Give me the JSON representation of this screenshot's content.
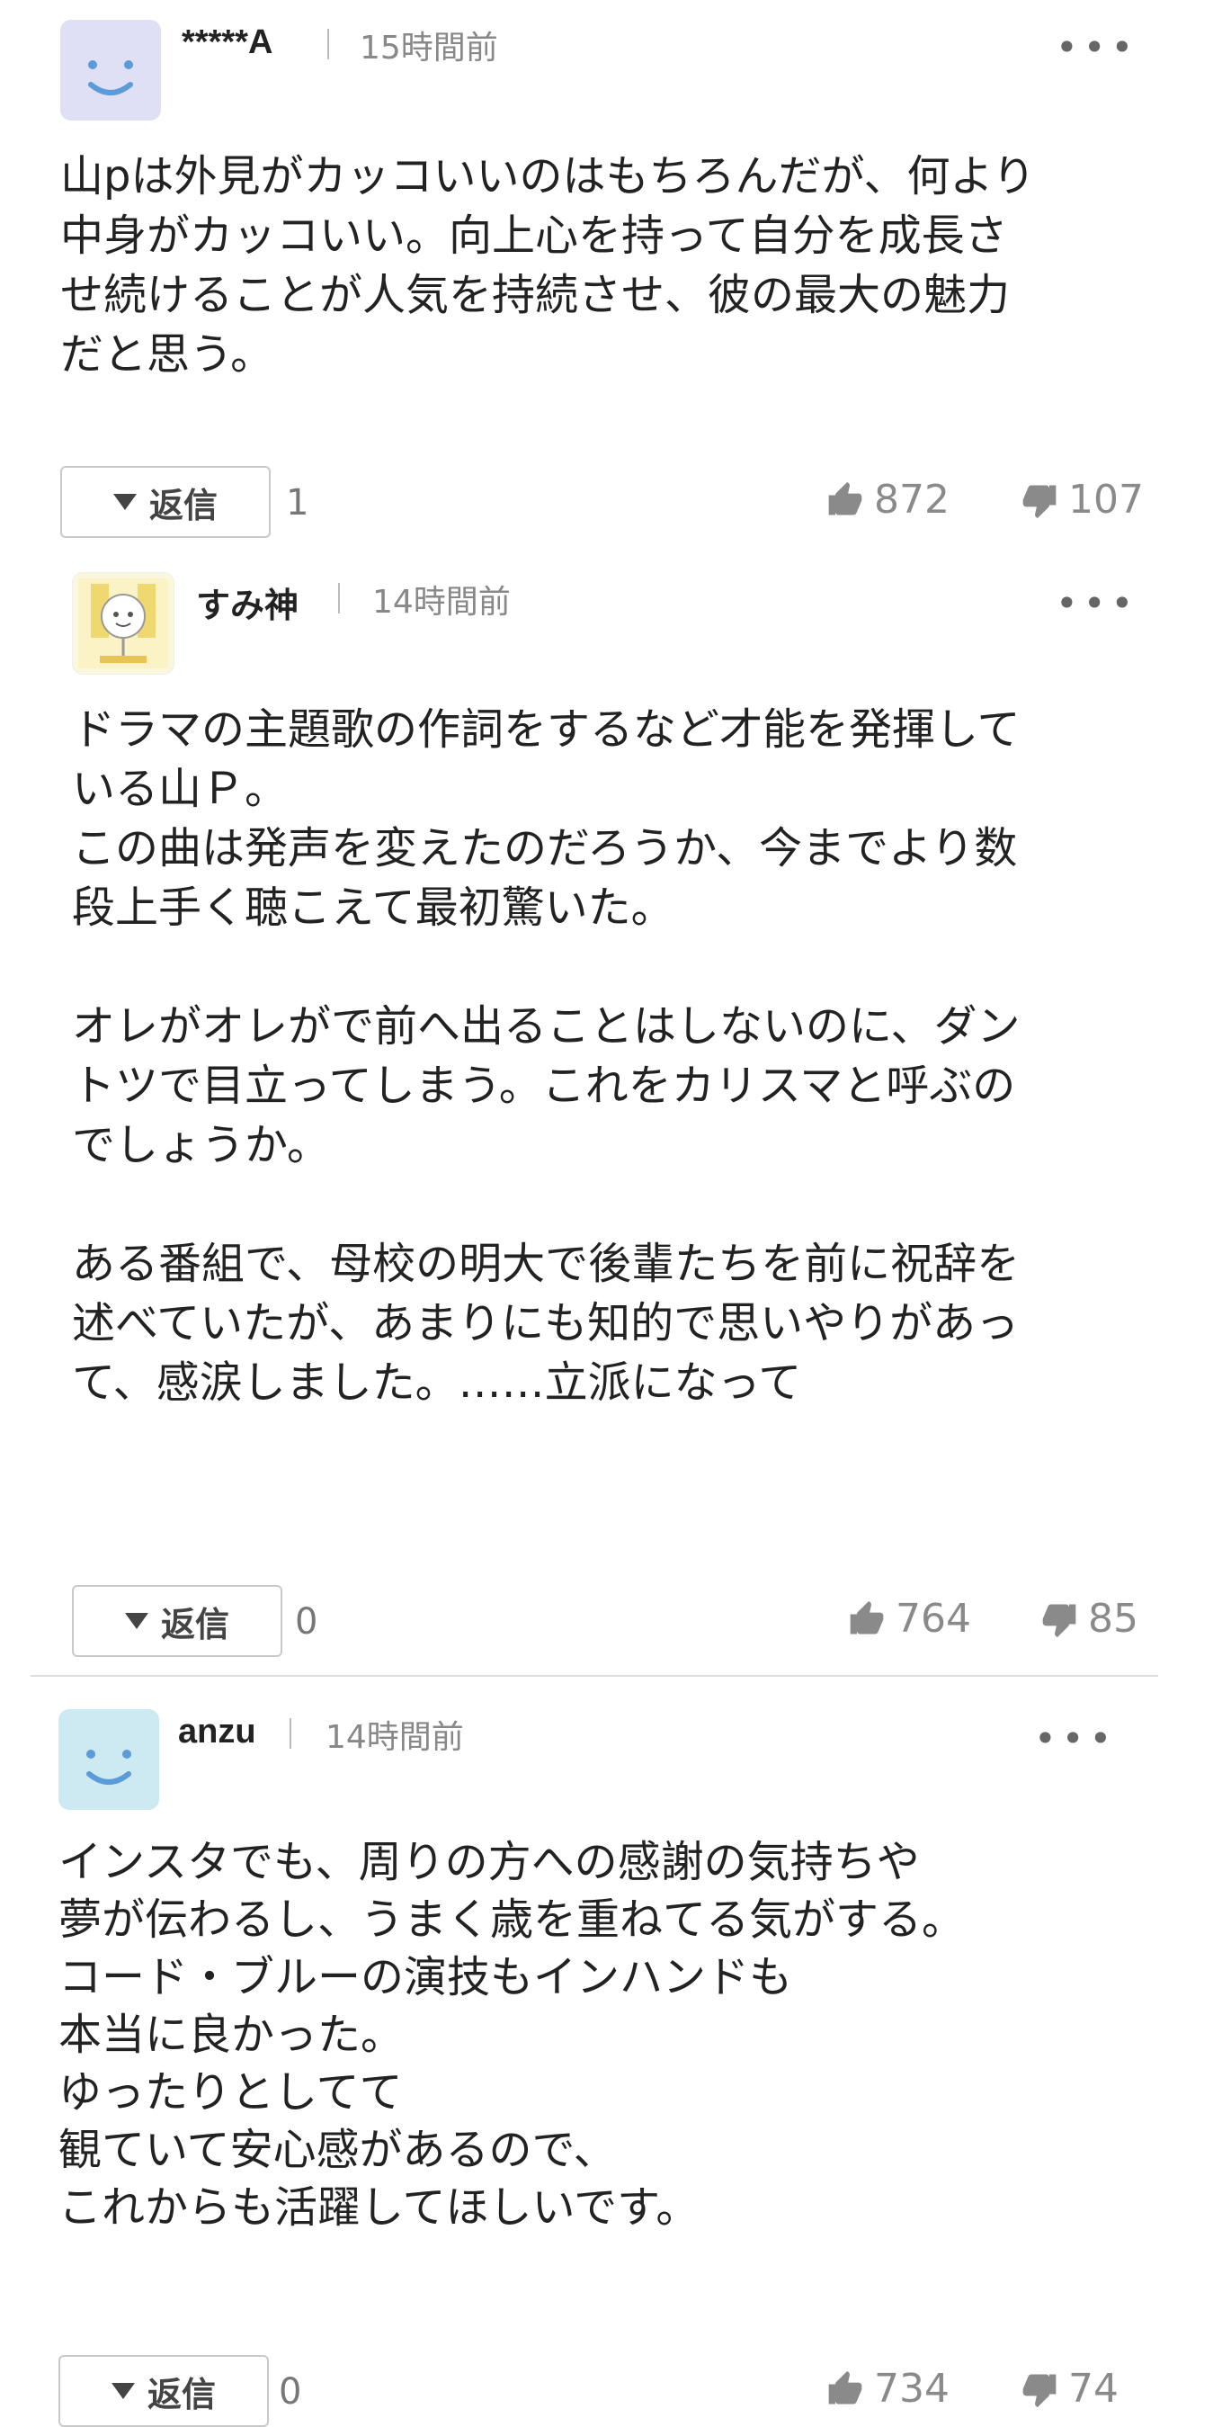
{
  "comments": [
    {
      "username": "*****A",
      "time": "15時間前",
      "text": "山pは外見がカッコいいのはもちろんだが、何より\n中身がカッコいい。向上心を持って自分を成長さ\nせ続けることが人気を持続させ、彼の最大の魅力\nだと思う。",
      "reply_label": "返信",
      "reply_count": "1",
      "likes": "872",
      "dislikes": "107",
      "avatar_color": "#dfe0f5"
    },
    {
      "username": "すみ神",
      "time": "14時間前",
      "text": "ドラマの主題歌の作詞をするなど才能を発揮して\nいる山Ｐ。\nこの曲は発声を変えたのだろうか、今までより数\n段上手く聴こえて最初驚いた。\n\nオレがオレがで前へ出ることはしないのに、ダン\nトツで目立ってしまう。これをカリスマと呼ぶの\nでしょうか。\n\nある番組で、母校の明大で後輩たちを前に祝辞を\n述べていたが、あまりにも知的で思いやりがあっ\nて、感涙しました。……立派になって",
      "reply_label": "返信",
      "reply_count": "0",
      "likes": "764",
      "dislikes": "85",
      "avatar_color": "#fbf3c6"
    },
    {
      "username": "anzu",
      "time": "14時間前",
      "text": "インスタでも、周りの方への感謝の気持ちや\n夢が伝わるし、うまく歳を重ねてる気がする。\nコード・ブルーの演技もインハンドも\n本当に良かった。\nゆったりとしてて\n観ていて安心感があるので、\nこれからも活躍してほしいです。",
      "reply_label": "返信",
      "reply_count": "0",
      "likes": "734",
      "dislikes": "74",
      "avatar_color": "#cde9f1"
    }
  ],
  "icons": {
    "more": "more-dots-icon",
    "like": "thumbs-up-icon",
    "dislike": "thumbs-down-icon",
    "reply_toggle": "triangle-down-icon"
  },
  "colors": {
    "text": "#222222",
    "muted": "#888888",
    "smiley": "#5a9bd8"
  }
}
